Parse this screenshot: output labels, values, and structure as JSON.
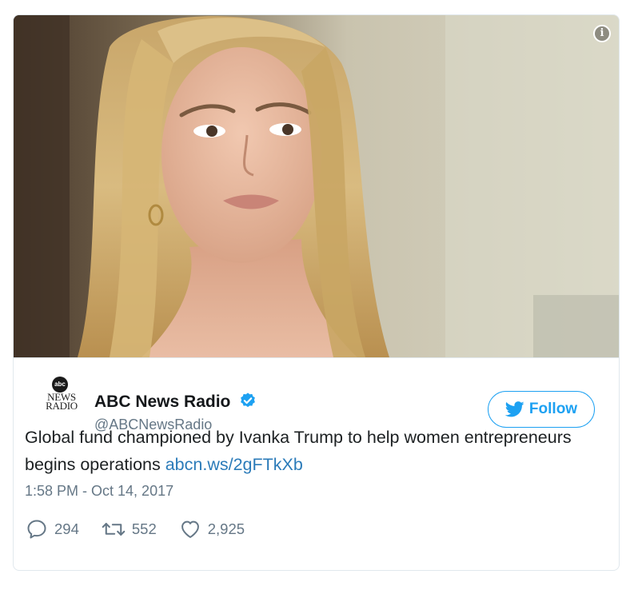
{
  "tweet": {
    "display_name": "ABC News Radio",
    "handle": "@ABCNewsRadio",
    "follow_label": "Follow",
    "text": "Global fund championed by Ivanka Trump to help women entrepreneurs begins operations",
    "link_text": "abcn.ws/2gFTkXb",
    "timestamp": "1:58 PM - Oct 14, 2017",
    "replies": "294",
    "retweets": "552",
    "likes": "2,925",
    "avatar": {
      "logo_text": "abc",
      "line1": "NEWS",
      "line2": "RADIO"
    }
  },
  "icons": {
    "info": "info-icon",
    "verified": "verified-badge-icon",
    "follow_bird": "twitter-bird-icon",
    "reply": "reply-bubble-icon",
    "retweet": "retweet-arrows-icon",
    "like": "heart-icon"
  },
  "colors": {
    "accent": "#1da1f2",
    "link": "#2b7bb9",
    "secondary_text": "#657786",
    "primary_text": "#1c2022"
  }
}
